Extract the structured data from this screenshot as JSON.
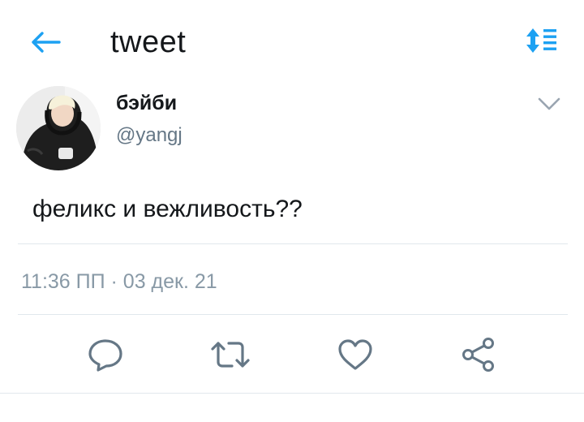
{
  "header": {
    "back_icon": "arrow-left-icon",
    "title": "tweet",
    "sort_icon": "sort-list-icon",
    "accent_color": "#1da1f2"
  },
  "tweet": {
    "author": {
      "display_name": "бэйби",
      "handle": "@yangj",
      "avatar": "avatar-photo"
    },
    "menu_icon": "chevron-down-icon",
    "text": "феликс и вежливость??",
    "timestamp": "11:36 ПП · 03 дек. 21"
  },
  "actions": [
    {
      "icon": "reply-icon"
    },
    {
      "icon": "retweet-icon"
    },
    {
      "icon": "like-icon"
    },
    {
      "icon": "share-icon"
    }
  ],
  "colors": {
    "text": "#14171a",
    "secondary": "#657786",
    "icon_gray": "#657786",
    "divider": "#e1e8ed"
  }
}
